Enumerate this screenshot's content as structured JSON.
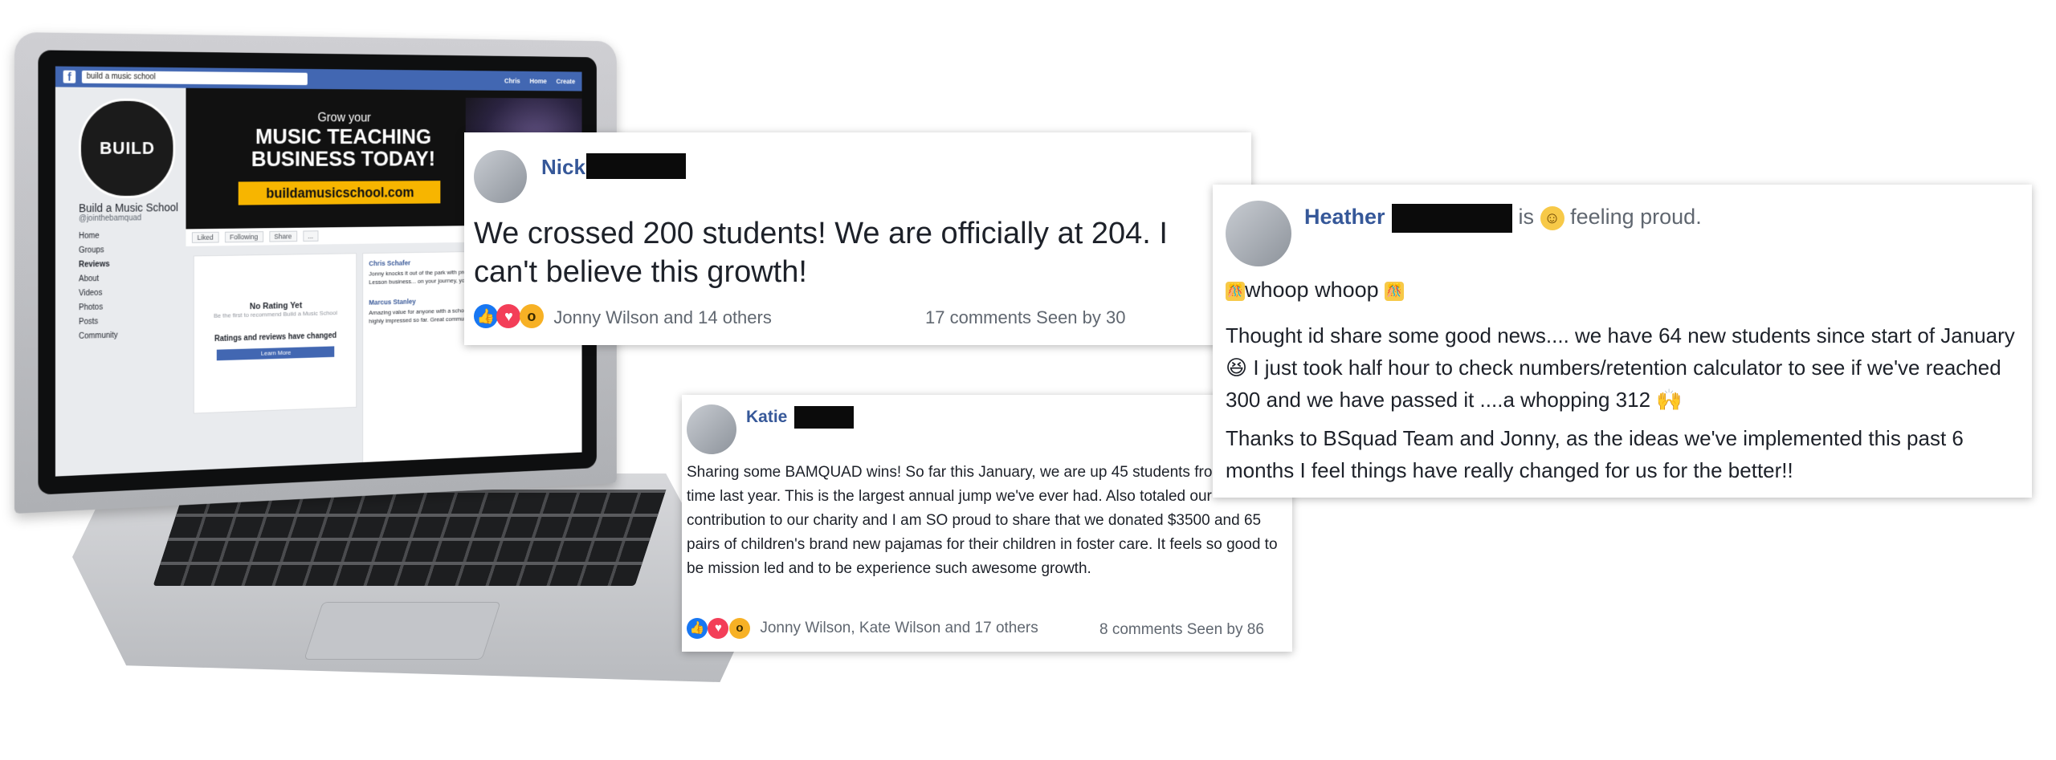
{
  "fb": {
    "search_value": "build a music school",
    "nav": [
      "Chris",
      "Home",
      "Create"
    ],
    "cover": {
      "grow": "Grow your",
      "headline": "MUSIC TEACHING BUSINESS TODAY!",
      "url": "buildamusicschool.com"
    },
    "avatar_text": "BUILD",
    "page_name": "Build a Music School",
    "handle": "@jointhebamquad",
    "left_nav": [
      "Home",
      "Groups",
      "Reviews",
      "About",
      "Videos",
      "Photos",
      "Posts",
      "Community"
    ],
    "actions": [
      "Liked",
      "Following",
      "Share",
      "..."
    ],
    "rating": {
      "title": "No Rating Yet",
      "sub": "Be the first to recommend Build a Music School",
      "changed": "Ratings and reviews have changed",
      "button": "Learn More"
    },
    "reviews": [
      {
        "author": "Chris Schafer",
        "text": "Jonny knocks it out of the park with professional video production with... flourish in the Music Lesson business... on your journey, you will gain massive..."
      },
      {
        "author": "Marcus Stanley",
        "text": "Amazing value for anyone with a school of any size. I'm less than a month in and have been highly impressed so far. Great community as well."
      }
    ]
  },
  "posts": {
    "nick": {
      "name": "Nick",
      "body": "We crossed 200 students! We are officially at 204. I can't believe this growth!",
      "reactors": "Jonny Wilson and 14 others",
      "stats": "17 comments  Seen by 30"
    },
    "katie": {
      "name": "Katie",
      "body": "Sharing some BAMQUAD wins! So far this January, we are up 45 students from this time last year. This is the largest annual jump we've ever had. Also totaled our contribution to our charity and I am SO proud to share that we donated $3500 and 65 pairs of children's brand new pajamas for their children in foster care. It feels so good to be mission led and to be experience such awesome growth.",
      "reactors": "Jonny Wilson, Kate Wilson and 17 others",
      "stats": "8 comments  Seen by 86"
    },
    "heather": {
      "name": "Heather",
      "is": "is",
      "feeling": "feeling proud.",
      "whoop": "whoop whoop",
      "p1": "Thought id share some good news.... we have 64 new students since start of January 😆 I just took half hour to check numbers/retention calculator to see if we've reached 300 and we have passed it ....a whopping 312 🙌",
      "p2": "Thanks to BSquad Team and Jonny, as the ideas we've implemented this past 6 months I feel things have really changed for us for the better!!"
    }
  },
  "colors": {
    "fb_blue": "#4267b2",
    "name_blue": "#365899",
    "like": "#1877f2",
    "love": "#f33e58",
    "wow": "#f7b125"
  }
}
